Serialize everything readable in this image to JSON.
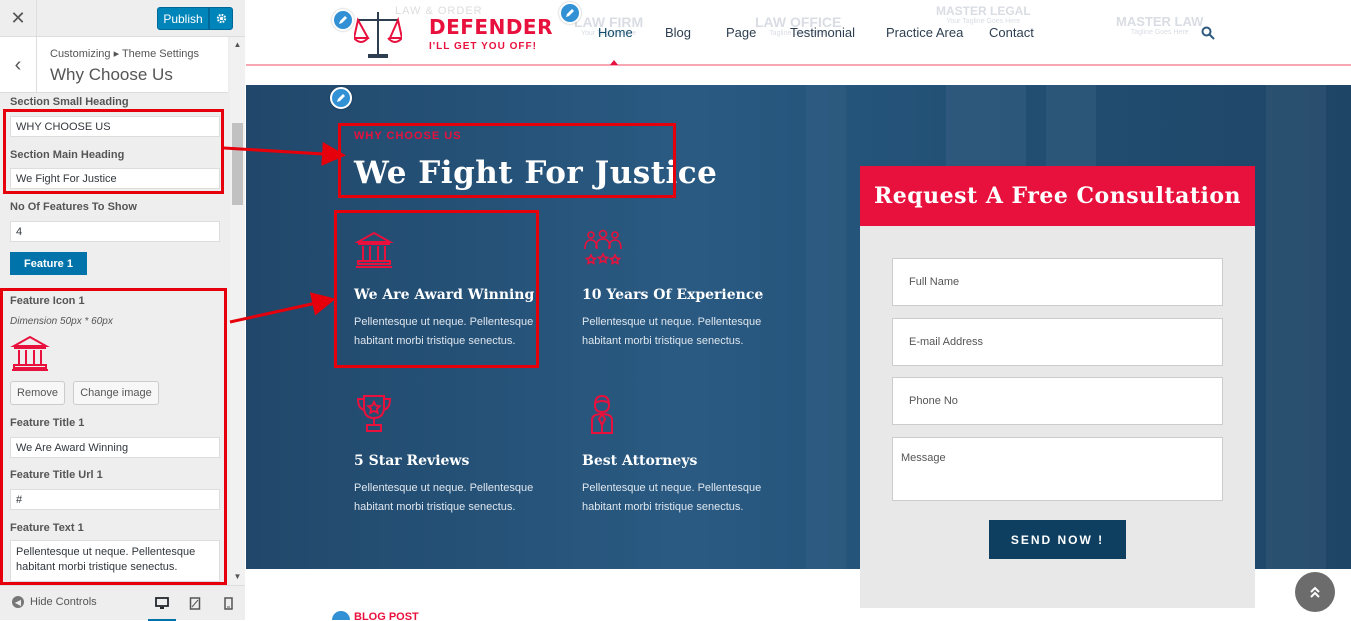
{
  "customizer": {
    "close_icon": "close-icon",
    "publish_label": "Publish",
    "breadcrumb": "Customizing ▸ Theme Settings",
    "section_title": "Why Choose Us",
    "fields": {
      "small_heading_label": "Section Small Heading",
      "small_heading_value": "WHY CHOOSE US",
      "main_heading_label": "Section Main Heading",
      "main_heading_value": "We Fight For Justice",
      "count_label": "No Of Features To Show",
      "count_value": "4",
      "feature_button": "Feature 1",
      "icon_label": "Feature Icon 1",
      "icon_dimension": "Dimension 50px * 60px",
      "remove_label": "Remove",
      "change_label": "Change image",
      "title_label": "Feature Title 1",
      "title_value": "We Are Award Winning",
      "url_label": "Feature Title Url 1",
      "url_value": "#",
      "text_label": "Feature Text 1",
      "text_value": "Pellentesque ut neque. Pellentesque habitant morbi tristique senectus."
    },
    "hide_controls": "Hide Controls"
  },
  "site": {
    "logo": {
      "top": "LAW & ORDER",
      "name": "DEFENDER",
      "tagline": "I'LL GET YOU OFF!"
    },
    "ghost_logos": [
      {
        "name": "LAW FIRM",
        "tag": "Your Tagline Here"
      },
      {
        "name": "LAW OFFICE",
        "tag": "Tagline Goes Here"
      },
      {
        "name": "MASTER LEGAL",
        "tag": "Your Tagline Goes Here"
      },
      {
        "name": "MASTER LAW",
        "tag": "Tagline Goes Here"
      }
    ],
    "nav": [
      "Home",
      "Blog",
      "Page",
      "Testimonial",
      "Practice Area",
      "Contact"
    ],
    "why_choose": {
      "small": "WHY CHOOSE US",
      "main": "We Fight For Justice"
    },
    "features": [
      {
        "icon": "courthouse-icon",
        "title": "We Are Award Winning",
        "text": "Pellentesque ut neque. Pellentesque habitant morbi tristique senectus."
      },
      {
        "icon": "team-icon",
        "title": "10 Years Of Experience",
        "text": "Pellentesque ut neque. Pellentesque habitant morbi tristique senectus."
      },
      {
        "icon": "trophy-icon",
        "title": "5 Star Reviews",
        "text": "Pellentesque ut neque. Pellentesque habitant morbi tristique senectus."
      },
      {
        "icon": "attorney-icon",
        "title": "Best Attorneys",
        "text": "Pellentesque ut neque. Pellentesque habitant morbi tristique senectus."
      }
    ],
    "form": {
      "title": "Request A Free Consultation",
      "name_ph": "Full Name",
      "email_ph": "E-mail Address",
      "phone_ph": "Phone No",
      "message_ph": "Message",
      "send": "SEND NOW !"
    },
    "blog_post": "BLOG POST"
  },
  "colors": {
    "accent": "#e8113d",
    "wp_blue": "#0085ba",
    "navy": "#0e3f60"
  }
}
